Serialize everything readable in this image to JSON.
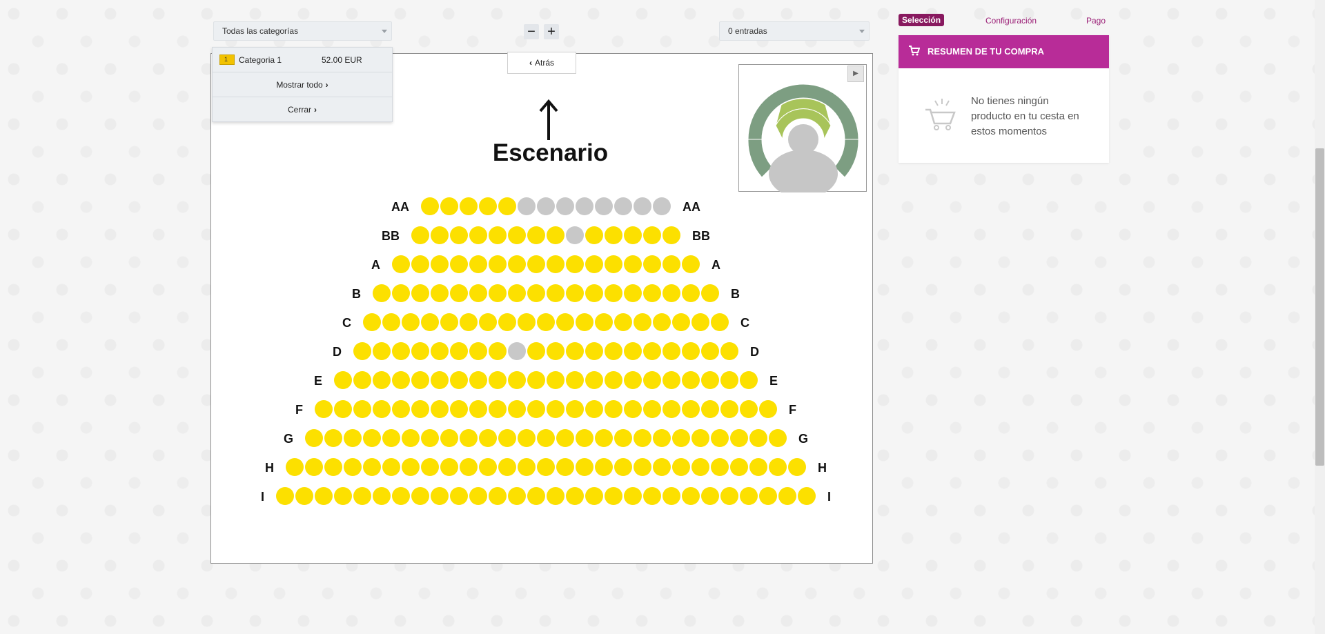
{
  "toolbar": {
    "category_select": "Todas las categorías",
    "tickets_select": "0 entradas",
    "zoom_out": "−",
    "zoom_in": "+"
  },
  "category_panel": {
    "badge": "1",
    "category_name": "Categoria 1",
    "category_price": "52.00 EUR",
    "show_all": "Mostrar todo",
    "close": "Cerrar"
  },
  "map": {
    "back_label": "Atrás",
    "stage_label": "Escenario"
  },
  "colors": {
    "available": "#fce000",
    "unavailable": "#c8c8c8",
    "accent": "#b82c98",
    "accent_dark": "#88195f"
  },
  "seat_rows": [
    {
      "label": "AA",
      "label_right": "AA",
      "count": 13,
      "unavailable": [
        6,
        7,
        8,
        9,
        10,
        11,
        12,
        13
      ]
    },
    {
      "label": "BB",
      "label_right": "BB",
      "count": 14,
      "unavailable": [
        9
      ]
    },
    {
      "label": "A",
      "label_right": "A",
      "count": 16,
      "unavailable": []
    },
    {
      "label": "B",
      "label_right": "B",
      "count": 18,
      "unavailable": []
    },
    {
      "label": "C",
      "label_right": "C",
      "count": 19,
      "unavailable": []
    },
    {
      "label": "D",
      "label_right": "D",
      "count": 20,
      "unavailable": [
        9
      ]
    },
    {
      "label": "E",
      "label_right": "E",
      "count": 22,
      "unavailable": []
    },
    {
      "label": "F",
      "label_right": "F",
      "count": 24,
      "unavailable": []
    },
    {
      "label": "G",
      "label_right": "G",
      "count": 25,
      "unavailable": []
    },
    {
      "label": "H",
      "label_right": "H",
      "count": 27,
      "unavailable": []
    },
    {
      "label": "I",
      "label_right": "I",
      "count": 28,
      "unavailable": []
    }
  ],
  "steps": {
    "selection": "Selección",
    "configuration": "Configuración",
    "payment": "Pago"
  },
  "summary": {
    "title": "RESUMEN DE TU COMPRA",
    "empty_message": "No tienes ningún producto en tu cesta en estos momentos"
  }
}
